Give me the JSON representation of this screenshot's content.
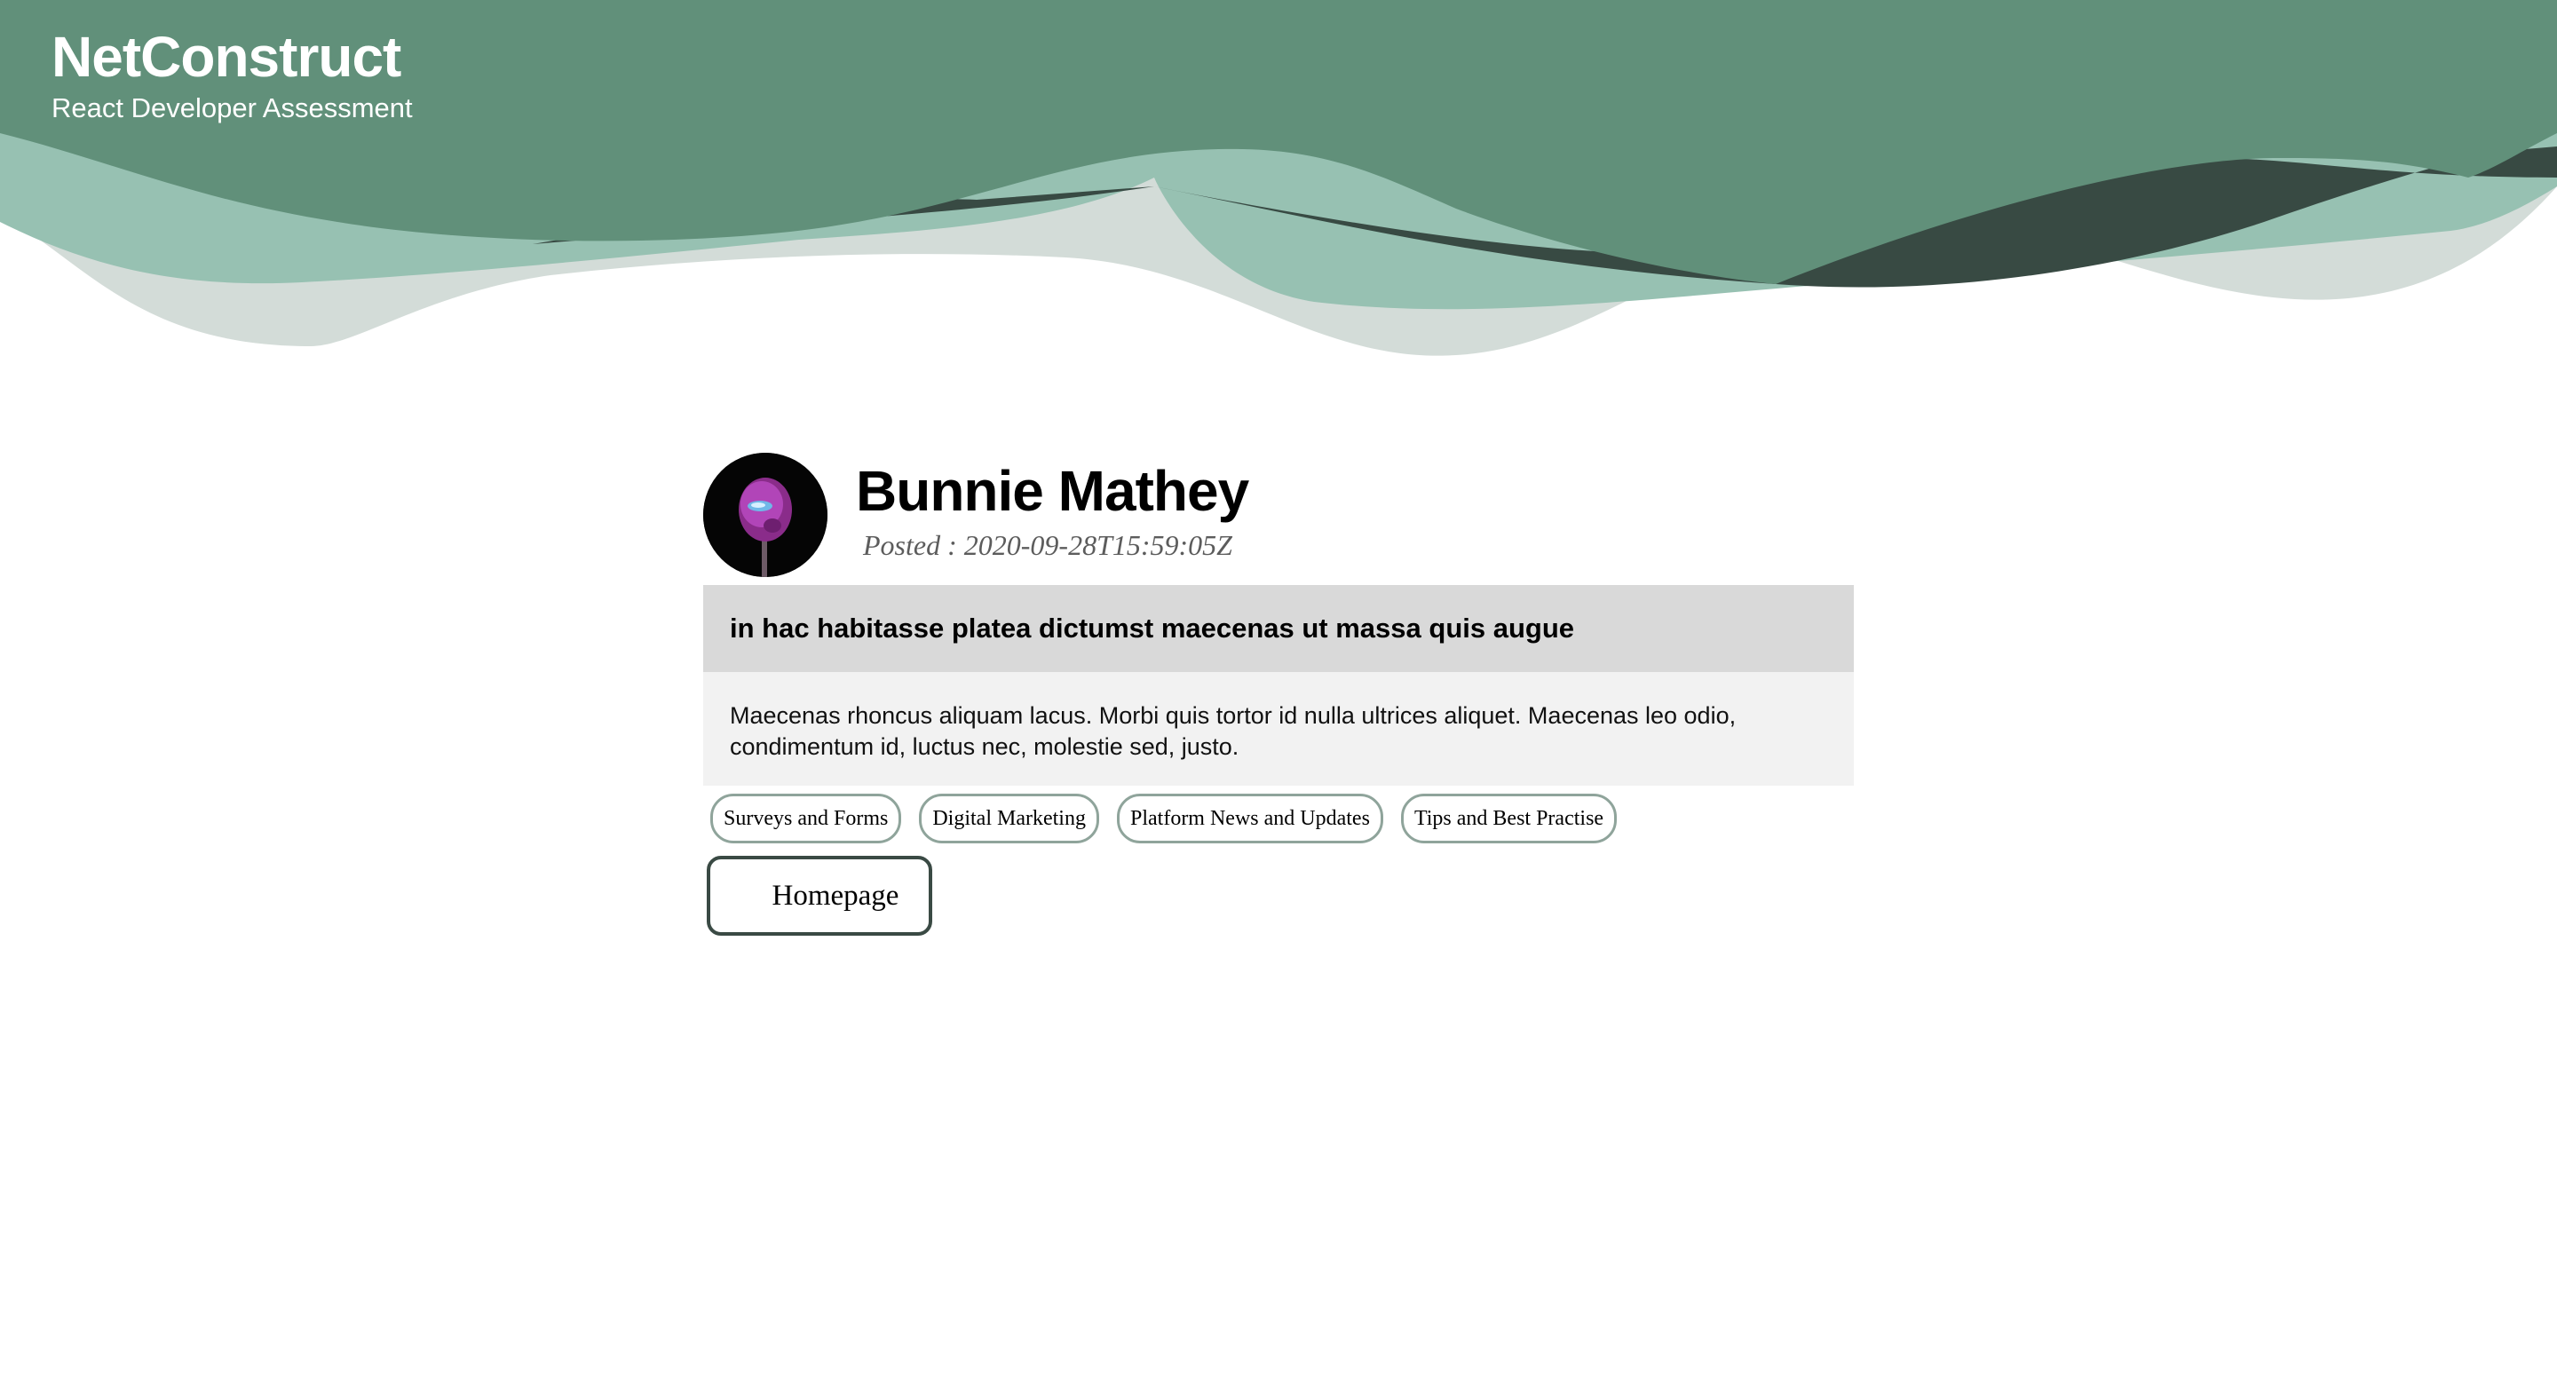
{
  "brand": {
    "title": "NetConstruct",
    "subtitle": "React Developer Assessment"
  },
  "colors": {
    "wave_primary": "#61907a",
    "wave_light": "#97c1b2",
    "wave_pale": "#d3dcd8",
    "wave_dark": "#384a43",
    "title_bar": "#d9d9d9",
    "body_bg": "#f2f2f2",
    "tag_border": "#8fa49b",
    "button_border": "#3a4a44"
  },
  "post": {
    "author": "Bunnie Mathey",
    "posted_label": "Posted",
    "posted_sep": ":",
    "posted_date": "2020-09-28T15:59:05Z",
    "title": "in hac habitasse platea dictumst maecenas ut massa quis augue",
    "body": "Maecenas rhoncus aliquam lacus. Morbi quis tortor id nulla ultrices aliquet. Maecenas leo odio, condimentum id, luctus nec, molestie sed, justo.",
    "avatar_icon": "avatar-image"
  },
  "tags": [
    "Surveys and Forms",
    "Digital Marketing",
    "Platform News and Updates",
    "Tips and Best Practise"
  ],
  "actions": {
    "homepage_label": "Homepage"
  }
}
